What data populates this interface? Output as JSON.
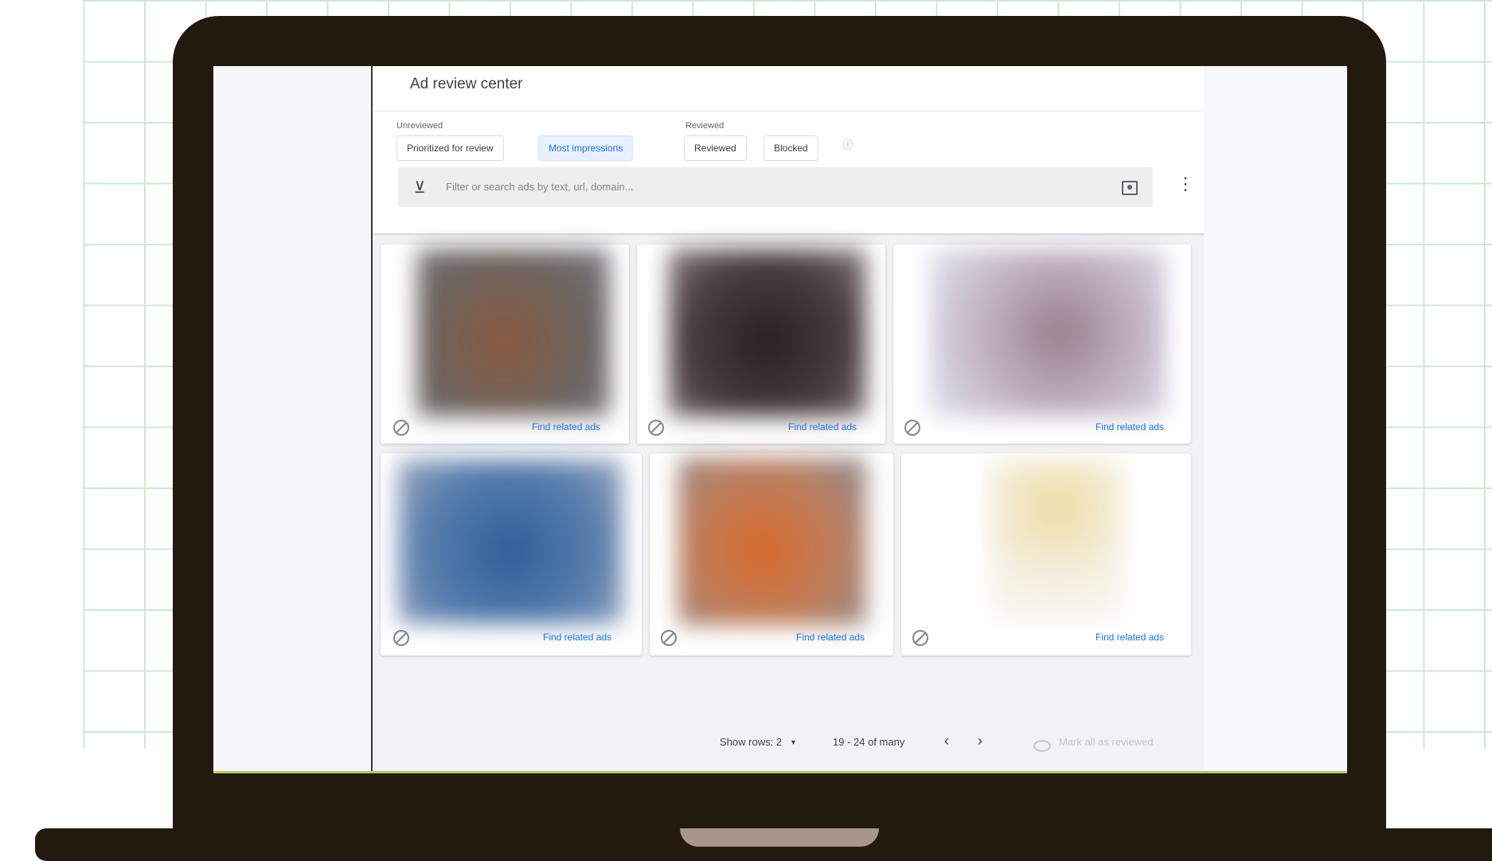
{
  "app": {
    "title": "Ad review center"
  },
  "filters": {
    "unreviewed_label": "Unreviewed",
    "reviewed_label": "Reviewed",
    "chips": {
      "prioritized": "Prioritized for review",
      "most_impressions": "Most impressions",
      "reviewed": "Reviewed",
      "blocked": "Blocked"
    },
    "selected_chip": "Most impressions"
  },
  "search": {
    "placeholder": "Filter or search ads by text, url, domain..."
  },
  "ads": [
    {
      "link": "Find related ads",
      "colors": [
        "#7d6a60",
        "#5a4a44"
      ]
    },
    {
      "link": "Find related ads",
      "colors": [
        "#3a2f2e",
        "#6a5a58"
      ]
    },
    {
      "link": "Find related ads",
      "colors": [
        "#c9b6c0",
        "#9a98b8"
      ]
    },
    {
      "link": "Find related ads",
      "colors": [
        "#3e6aa0",
        "#6a8ab8"
      ]
    },
    {
      "link": "Find related ads",
      "colors": [
        "#d46a30",
        "#b08060"
      ]
    },
    {
      "link": "Find related ads",
      "colors": [
        "#efe3bf",
        "#f6f2e8"
      ]
    }
  ],
  "pagination": {
    "show_rows_label": "Show rows: 2",
    "range": "19 - 24 of many",
    "mark_all_label": "Mark all as reviewed"
  },
  "colors": {
    "accent": "#1a73e8",
    "laptop": "#231a0f",
    "grid": "#cfe8d6"
  }
}
